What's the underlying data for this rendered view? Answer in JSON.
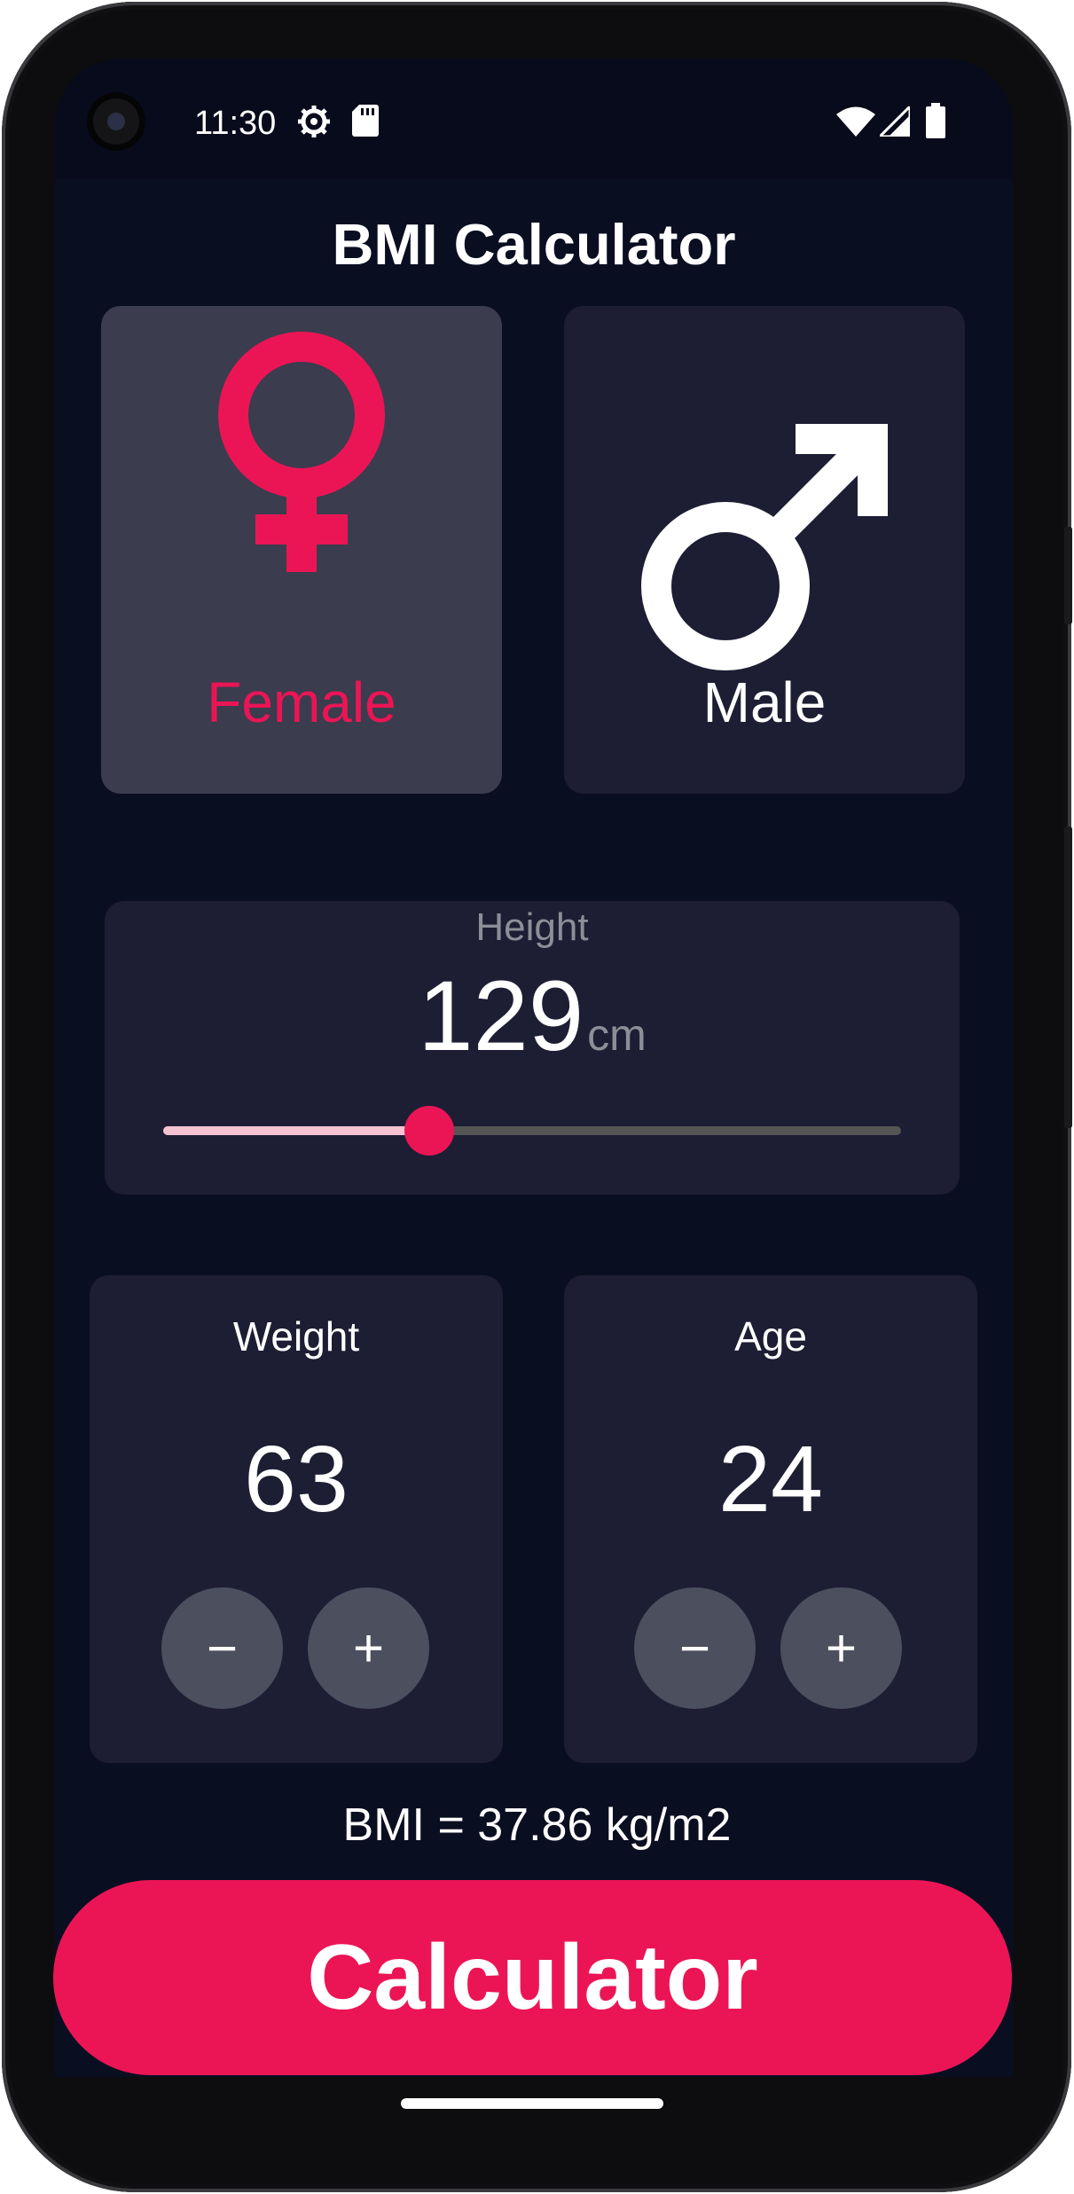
{
  "status_bar": {
    "time": "11:30",
    "icons": [
      "settings-gear-icon",
      "sd-card-icon",
      "wifi-icon",
      "cell-signal-icon",
      "battery-icon"
    ]
  },
  "app": {
    "title": "BMI Calculator"
  },
  "gender": {
    "female_label": "Female",
    "male_label": "Male",
    "selected": "female"
  },
  "height": {
    "label": "Height",
    "value": "129",
    "unit": "cm",
    "slider_fraction": 0.36
  },
  "weight": {
    "label": "Weight",
    "value": "63",
    "minus": "−",
    "plus": "+"
  },
  "age": {
    "label": "Age",
    "value": "24",
    "minus": "−",
    "plus": "+"
  },
  "result": {
    "text": "BMI = 37.86 kg/m2"
  },
  "action": {
    "button_label": "Calculator"
  },
  "colors": {
    "background": "#0a0e21",
    "card": "#1d1e33",
    "card_selected": "#3b3c4e",
    "accent": "#eb1555",
    "button": "#4c4f5e",
    "muted_text": "#8d8e98"
  }
}
